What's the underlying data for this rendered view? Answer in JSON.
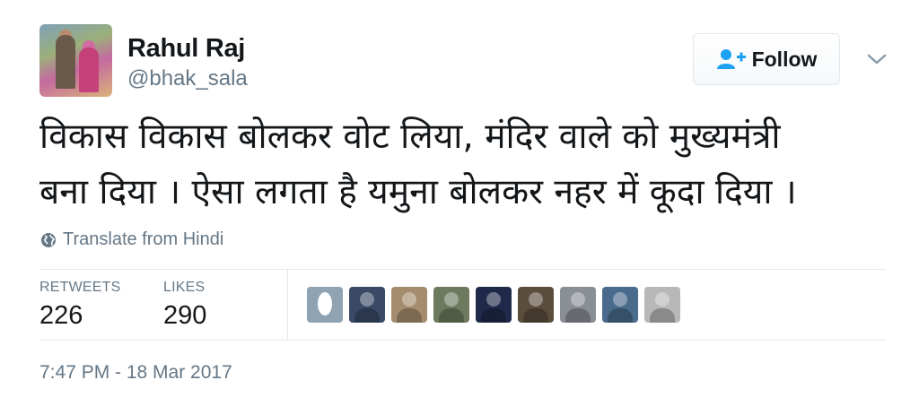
{
  "user": {
    "name": "Rahul Raj",
    "handle": "@bhak_sala"
  },
  "follow_button": {
    "label": "Follow",
    "icon": "add-user-icon",
    "color": "#1da1f2"
  },
  "tweet": {
    "text": "विकास विकास बोलकर वोट लिया, मंदिर वाले को मुख्यमंत्री\nबना दिया । ऐसा लगता है यमुना बोलकर नहर में कूदा दिया ।",
    "translate_label": "Translate from Hindi",
    "timestamp": "7:47 PM - 18 Mar 2017"
  },
  "stats": {
    "retweets_label": "RETWEETS",
    "retweets": "226",
    "likes_label": "LIKES",
    "likes": "290"
  },
  "likers": [
    {
      "name": "liker-avatar-1",
      "color": "#8fa3b3",
      "egg": true
    },
    {
      "name": "liker-avatar-2",
      "color": "#3a4a66"
    },
    {
      "name": "liker-avatar-3",
      "color": "#a58c6e"
    },
    {
      "name": "liker-avatar-4",
      "color": "#6d7a5e"
    },
    {
      "name": "liker-avatar-5",
      "color": "#1f2a4a"
    },
    {
      "name": "liker-avatar-6",
      "color": "#5a4d3c"
    },
    {
      "name": "liker-avatar-7",
      "color": "#8a8f96"
    },
    {
      "name": "liker-avatar-8",
      "color": "#4a6b8c"
    },
    {
      "name": "liker-avatar-9",
      "color": "#b8b8b8"
    }
  ],
  "colors": {
    "text": "#14171a",
    "muted": "#657786",
    "border": "#e1e8ed"
  }
}
